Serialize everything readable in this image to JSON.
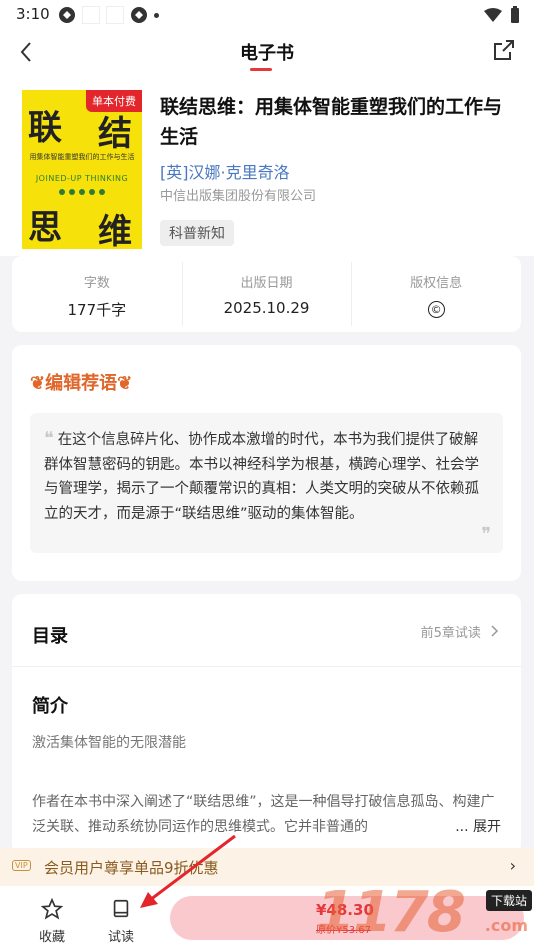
{
  "status_bar": {
    "time": "3:10"
  },
  "header": {
    "title": "电子书"
  },
  "book": {
    "cover": {
      "badge": "单本付费",
      "char1": "联",
      "char2": "结",
      "char3": "思",
      "char4": "维",
      "subtitle": "用集体智能重塑我们的工作与生活",
      "english": "JOINED-UP THINKING"
    },
    "title": "联结思维：用集体智能重塑我们的工作与生活",
    "author": "[英]汉娜·克里奇洛",
    "publisher": "中信出版集团股份有限公司",
    "tag": "科普新知"
  },
  "stats": [
    {
      "label": "字数",
      "value": "177千字"
    },
    {
      "label": "出版日期",
      "value": "2025.10.29"
    },
    {
      "label": "版权信息",
      "value": "©"
    }
  ],
  "recommendation": {
    "title": "编辑荐语",
    "text": "在这个信息碎片化、协作成本激增的时代，本书为我们提供了破解群体智慧密码的钥匙。本书以神经科学为根基，横跨心理学、社会学与管理学，揭示了一个颠覆常识的真相：人类文明的突破从不依赖孤立的天才，而是源于“联结思维”驱动的集体智能。"
  },
  "toc": {
    "title": "目录",
    "trial": "前5章试读",
    "intro_title": "简介",
    "intro_sub": "激活集体智能的无限潜能",
    "intro_text": "作者在本书中深入阐述了“联结思维”，这是一种倡导打破信息孤岛、构建广泛关联、推动系统协同运作的思维模式。它并非普通的",
    "expand": "... 展开"
  },
  "vip": {
    "badge": "VIP",
    "text": "会员用户尊享单品9折优惠"
  },
  "bottom": {
    "collect": "收藏",
    "trial_read": "试读",
    "price": "¥48.30",
    "orig_price": "原价¥53.67"
  },
  "watermark": {
    "text": "1178",
    "tag": "下载站",
    "domain": ".com"
  },
  "colors": {
    "accent": "#e5383b",
    "author": "#4a78c2",
    "cover": "#f6e20a"
  }
}
